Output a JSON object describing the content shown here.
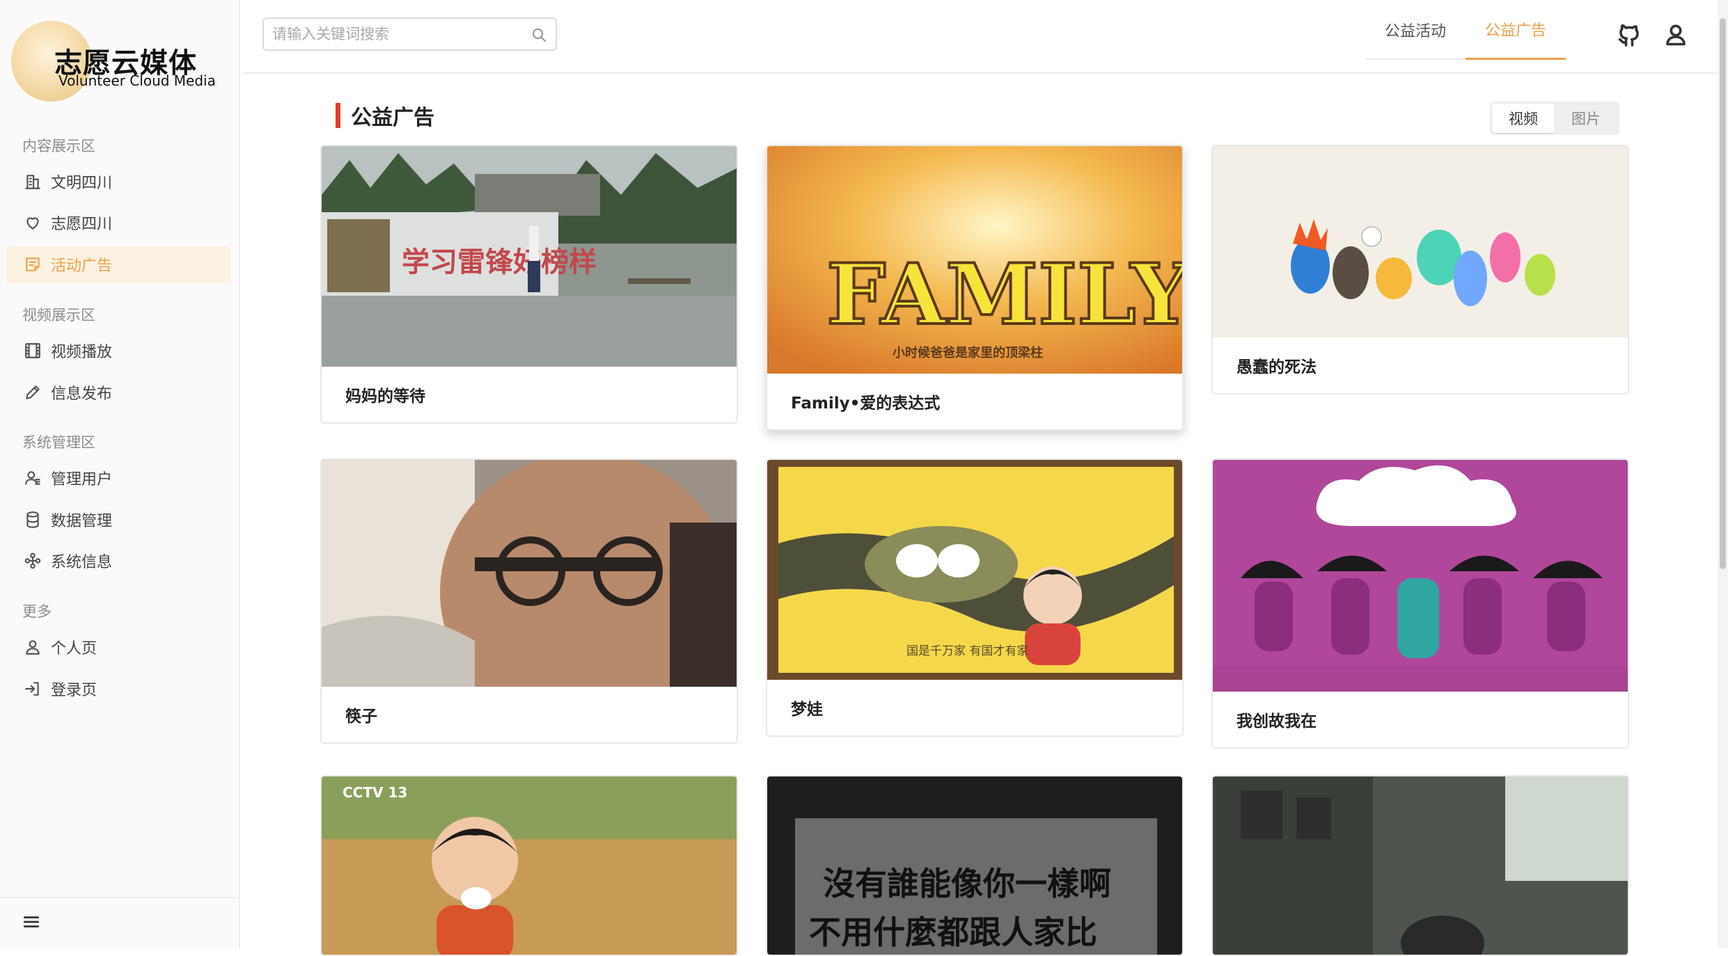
{
  "brand": {
    "title": "志愿云媒体",
    "subtitle": "Volunteer Cloud Media"
  },
  "sidebar": {
    "groups": [
      {
        "label": "内容展示区"
      },
      {
        "label": "视频展示区"
      },
      {
        "label": "系统管理区"
      },
      {
        "label": "更多"
      }
    ],
    "items": [
      {
        "label": "文明四川",
        "icon": "building-icon"
      },
      {
        "label": "志愿四川",
        "icon": "heart-icon"
      },
      {
        "label": "活动广告",
        "icon": "note-icon",
        "active": true
      },
      {
        "label": "视频播放",
        "icon": "film-icon"
      },
      {
        "label": "信息发布",
        "icon": "pencil-icon"
      },
      {
        "label": "管理用户",
        "icon": "user-manage-icon"
      },
      {
        "label": "数据管理",
        "icon": "database-icon"
      },
      {
        "label": "系统信息",
        "icon": "system-icon"
      },
      {
        "label": "个人页",
        "icon": "person-icon"
      },
      {
        "label": "登录页",
        "icon": "login-icon"
      }
    ],
    "footer_icon": "hamburger-menu-icon"
  },
  "header": {
    "search_placeholder": "请输入关键词搜索",
    "tabs": [
      {
        "label": "公益活动",
        "active": false
      },
      {
        "label": "公益广告",
        "active": true
      }
    ],
    "right_icons": [
      "github-icon",
      "user-icon"
    ]
  },
  "main": {
    "section_title": "公益广告",
    "view_switch": [
      {
        "label": "视频",
        "selected": true
      },
      {
        "label": "图片",
        "selected": false
      }
    ],
    "cards": [
      {
        "title": "妈妈的等待",
        "thumb_text": "学习雷锋好榜样"
      },
      {
        "title": "Family•爱的表达式",
        "thumb_text": "FAMILY",
        "thumb_caption": "小时候爸爸是家里的顶梁柱"
      },
      {
        "title": "愚蠢的死法"
      },
      {
        "title": "筷子"
      },
      {
        "title": "梦娃",
        "thumb_caption": "国是千万家 有国才有家"
      },
      {
        "title": "我创故我在"
      },
      {
        "title": "",
        "thumb_text": "CCTV 13"
      },
      {
        "title": "",
        "thumb_text": "沒有誰能像你一樣啊",
        "thumb_caption": "不用什麼都跟人家比"
      },
      {
        "title": ""
      }
    ]
  },
  "colors": {
    "accent": "#f0a14a",
    "title_bar": "#e83a2f"
  }
}
